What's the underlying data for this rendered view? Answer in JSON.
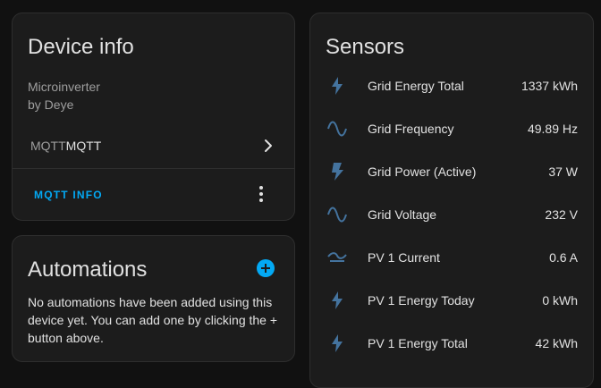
{
  "device_card": {
    "title": "Device info",
    "model": "Microinverter",
    "manufacturer": "by Deye",
    "integration_prefix": "MQTT",
    "integration_name": "MQTT",
    "action_label": "MQTT INFO"
  },
  "automations_card": {
    "title": "Automations",
    "description": "No automations have been added using this device yet. You can add one by clicking the + button above."
  },
  "sensors_card": {
    "title": "Sensors",
    "items": [
      {
        "name": "Grid Energy Total",
        "value": "1337 kWh",
        "icon": "lightning-bolt-outline-icon"
      },
      {
        "name": "Grid Frequency",
        "value": "49.89 Hz",
        "icon": "sine-wave-icon"
      },
      {
        "name": "Grid Power (Active)",
        "value": "37 W",
        "icon": "flash-icon"
      },
      {
        "name": "Grid Voltage",
        "value": "232 V",
        "icon": "sine-wave-icon"
      },
      {
        "name": "PV 1 Current",
        "value": "0.6 A",
        "icon": "current-dc-icon"
      },
      {
        "name": "PV 1 Energy Today",
        "value": "0 kWh",
        "icon": "lightning-bolt-outline-icon"
      },
      {
        "name": "PV 1 Energy Total",
        "value": "42 kWh",
        "icon": "lightning-bolt-outline-icon"
      }
    ]
  },
  "colors": {
    "accent": "#03a9f4",
    "icon": "#44739e",
    "card_bg": "#1c1c1c",
    "page_bg": "#111111"
  }
}
